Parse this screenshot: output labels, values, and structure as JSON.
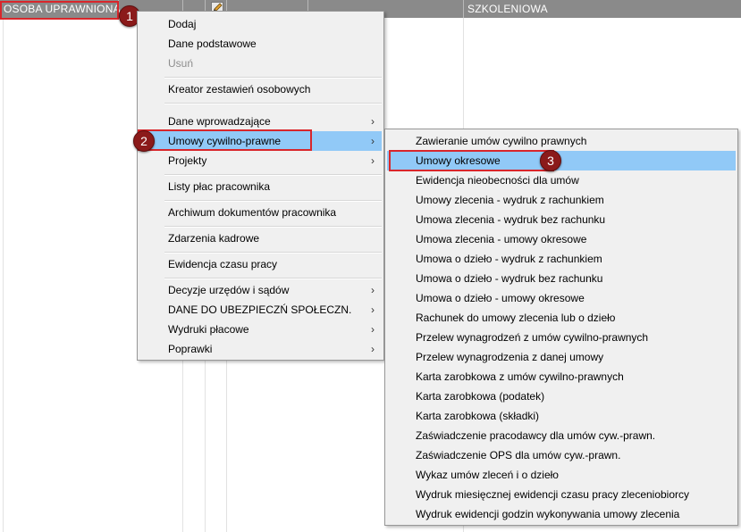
{
  "header": {
    "col1": "OSOBA UPRAWNIONA",
    "col2": "SZKOLENIOWA",
    "edit_icon": "pencil-icon"
  },
  "badges": {
    "one": "1",
    "two": "2",
    "three": "3"
  },
  "menu": {
    "items": [
      {
        "label": "Dodaj"
      },
      {
        "label": "Dane podstawowe"
      },
      {
        "label": "Usuń",
        "disabled": true
      },
      {
        "label": "Kreator zestawień osobowych"
      },
      {
        "label": "Dane wprowadzające",
        "submenu": true
      },
      {
        "label": "Umowy cywilno-prawne",
        "submenu": true,
        "highlighted": true
      },
      {
        "label": "Projekty",
        "submenu": true
      },
      {
        "label": "Listy płac pracownika"
      },
      {
        "label": "Archiwum dokumentów pracownika"
      },
      {
        "label": "Zdarzenia kadrowe"
      },
      {
        "label": "Ewidencja czasu pracy"
      },
      {
        "label": "Decyzje urzędów i sądów",
        "submenu": true
      },
      {
        "label": "DANE DO UBEZPIECZŃ SPOŁECZN.",
        "submenu": true
      },
      {
        "label": "Wydruki płacowe",
        "submenu": true
      },
      {
        "label": "Poprawki",
        "submenu": true
      }
    ],
    "arrow_icon": "chevron-right-icon"
  },
  "submenu": {
    "items": [
      {
        "label": "Zawieranie umów cywilno prawnych"
      },
      {
        "label": "Umowy okresowe",
        "highlighted": true
      },
      {
        "label": "Ewidencja nieobecności dla umów"
      },
      {
        "label": "Umowy zlecenia - wydruk z rachunkiem"
      },
      {
        "label": "Umowa zlecenia - wydruk bez rachunku"
      },
      {
        "label": "Umowa zlecenia - umowy okresowe"
      },
      {
        "label": "Umowa o dzieło - wydruk z rachunkiem"
      },
      {
        "label": "Umowa o dzieło - wydruk bez rachunku"
      },
      {
        "label": "Umowa o dzieło - umowy okresowe"
      },
      {
        "label": "Rachunek do umowy zlecenia lub o dzieło"
      },
      {
        "label": "Przelew wynagrodzeń z umów cywilno-prawnych"
      },
      {
        "label": "Przelew wynagrodzenia z danej umowy"
      },
      {
        "label": "Karta zarobkowa z umów cywilno-prawnych"
      },
      {
        "label": "Karta zarobkowa (podatek)"
      },
      {
        "label": "Karta zarobkowa (składki)"
      },
      {
        "label": "Zaświadczenie pracodawcy dla umów cyw.-prawn."
      },
      {
        "label": "Zaświadczenie OPS dla umów cyw.-prawn."
      },
      {
        "label": "Wykaz umów zleceń i o dzieło"
      },
      {
        "label": "Wydruk miesięcznej ewidencji czasu pracy zleceniobiorcy"
      },
      {
        "label": "Wydruk ewidencji godzin wykonywania umowy zlecenia"
      }
    ]
  }
}
